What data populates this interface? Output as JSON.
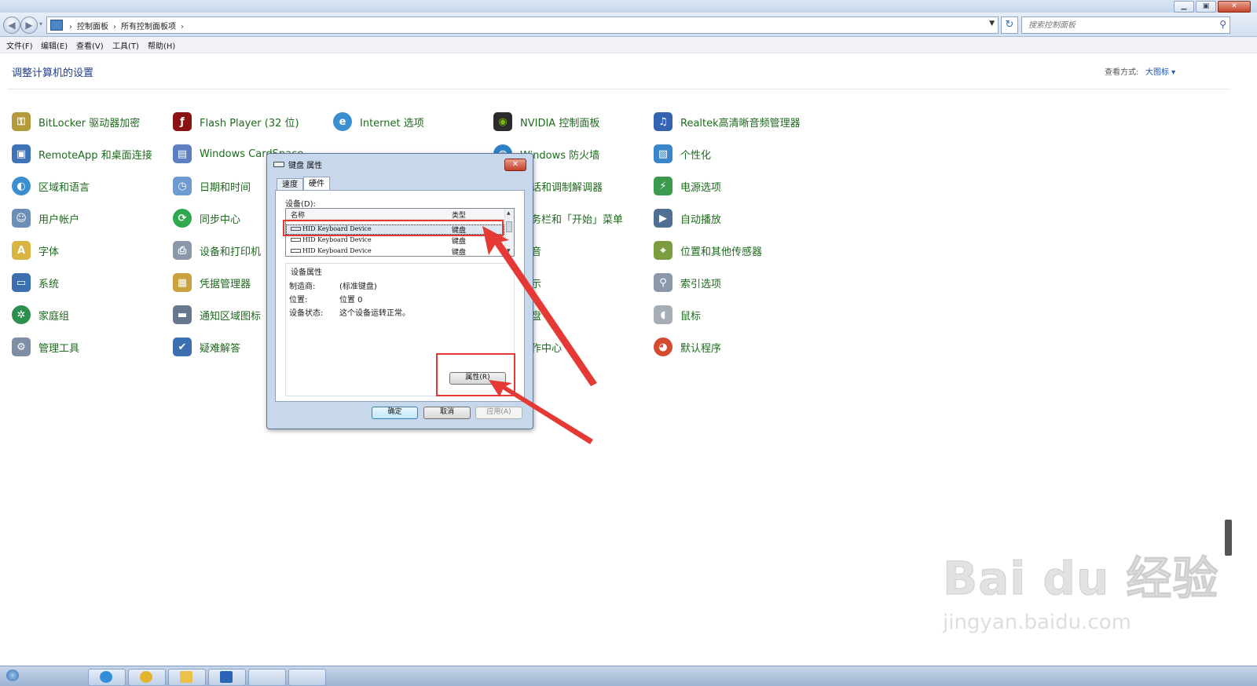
{
  "window": {
    "address": {
      "crumbs": [
        "控制面板",
        "所有控制面板项"
      ]
    },
    "search_placeholder": "搜索控制面板",
    "menu": [
      "文件(F)",
      "编辑(E)",
      "查看(V)",
      "工具(T)",
      "帮助(H)"
    ]
  },
  "content": {
    "title": "调整计算机的设置",
    "view_by_label": "查看方式:",
    "view_by_value": "大图标 ▾",
    "items": {
      "col1": [
        "BitLocker 驱动器加密",
        "RemoteApp 和桌面连接",
        "区域和语言",
        "用户帐户",
        "字体",
        "系统",
        "家庭组",
        "管理工具"
      ],
      "col2": [
        "Flash Player (32 位)",
        "Windows CardSpace",
        "日期和时间",
        "同步中心",
        "设备和打印机",
        "凭据管理器",
        "通知区域图标",
        "疑难解答"
      ],
      "col3_visible": [
        "Internet 选项"
      ],
      "col4_visible": [
        "NVIDIA 控制面板",
        "Windows 防火墙",
        "话和调制解调器",
        "务栏和「开始」菜单",
        "音",
        "示",
        "盘",
        "作中心"
      ],
      "col5": [
        "Realtek高清晰音频管理器",
        "个性化",
        "电源选项",
        "自动播放",
        "位置和其他传感器",
        "索引选项",
        "鼠标",
        "默认程序"
      ]
    }
  },
  "dialog": {
    "title": "键盘 属性",
    "close": "✕",
    "tabs": [
      "速度",
      "硬件"
    ],
    "devices_label": "设备(D):",
    "columns": [
      "名称",
      "类型"
    ],
    "devices": [
      {
        "name": "HID Keyboard Device",
        "type": "键盘"
      },
      {
        "name": "HID Keyboard Device",
        "type": "键盘"
      },
      {
        "name": "HID Keyboard Device",
        "type": "键盘"
      }
    ],
    "props_title": "设备属性",
    "props": [
      {
        "label": "制造商:",
        "value": "(标准键盘)"
      },
      {
        "label": "位置:",
        "value": "位置 0"
      },
      {
        "label": "设备状态:",
        "value": "这个设备运转正常。"
      }
    ],
    "properties_button": "属性(R)",
    "buttons": {
      "ok": "确定",
      "cancel": "取消",
      "apply": "应用(A)"
    }
  },
  "annotation_color": "#e53935",
  "watermark": {
    "logo": "Bai du 经验",
    "url": "jingyan.baidu.com"
  }
}
